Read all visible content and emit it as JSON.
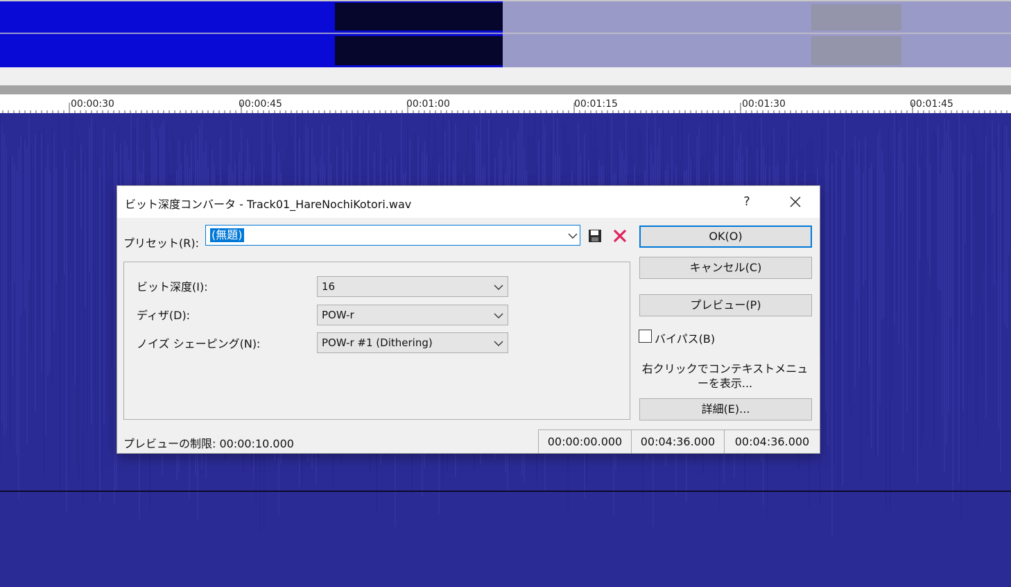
{
  "ruler": {
    "labels": [
      "00:00:30",
      "00:00:45",
      "00:01:00",
      "00:01:15",
      "00:01:30",
      "00:01:45"
    ]
  },
  "colors": {
    "waveform_bg": "#2b2b96",
    "overview_selected": "#0a0ad6",
    "overview_unselected": "#9a9ac9",
    "accent": "#0078d7",
    "delete": "#e0245e"
  },
  "dialog": {
    "title": "ビット深度コンバータ - Track01_HareNochiKotori.wav",
    "help_glyph": "?",
    "preset": {
      "label": "プリセット(R):",
      "value": "(無題)"
    },
    "fields": [
      {
        "label": "ビット深度(I):",
        "value": "16"
      },
      {
        "label": "ディザ(D):",
        "value": "POW-r"
      },
      {
        "label": "ノイズ シェーピング(N):",
        "value": "POW-r #1 (Dithering)"
      }
    ],
    "buttons": {
      "ok": "OK(O)",
      "cancel": "キャンセル(C)",
      "preview": "プレビュー(P)",
      "details": "詳細(E)..."
    },
    "bypass": {
      "label": "バイパス(B)",
      "checked": false
    },
    "context_hint": "右クリックでコンテキストメニューを表示...",
    "preview_limit": "プレビューの制限: 00:00:10.000",
    "times": [
      "00:00:00.000",
      "00:04:36.000",
      "00:04:36.000"
    ]
  }
}
